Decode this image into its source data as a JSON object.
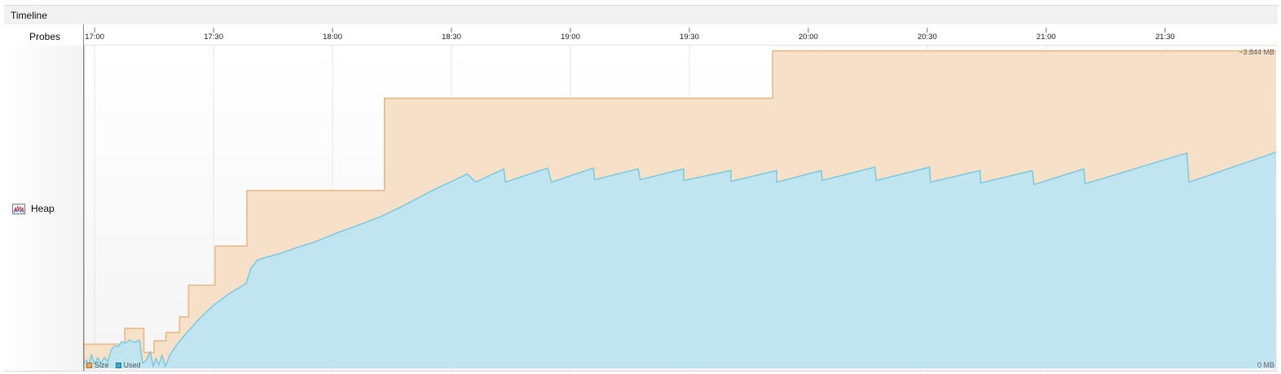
{
  "window": {
    "title": "Timeline"
  },
  "left_panel": {
    "probes_label": "Probes",
    "heap_label": "Heap"
  },
  "chart_labels": {
    "max": "~3.844 MB",
    "min": "0 MB"
  },
  "legend": {
    "size_label": "Size",
    "used_label": "Used"
  },
  "colors": {
    "size_fill": "#f5dec4",
    "size_line": "#e9b98a",
    "used_fill": "#bde5f3",
    "used_line": "#7ecbe0",
    "grid": "#e6e6e6"
  },
  "chart_data": {
    "type": "area",
    "title": "",
    "xlabel": "",
    "ylabel": "",
    "x_ticks": [
      "17:00",
      "17:30",
      "18:00",
      "18:30",
      "19:00",
      "19:30",
      "20:00",
      "20:30",
      "21:00",
      "21:30"
    ],
    "x_tick_minutes": [
      0,
      30,
      60,
      90,
      120,
      150,
      180,
      210,
      240,
      270
    ],
    "xlim_minutes": [
      -2.7,
      298
    ],
    "ylim_mb": [
      0,
      3.844
    ],
    "grid": true,
    "legend_position": "bottom-left",
    "series": [
      {
        "name": "Size",
        "step": true,
        "points": [
          [
            -2.7,
            0.29
          ],
          [
            7.6,
            0.29
          ],
          [
            7.6,
            0.48
          ],
          [
            12.4,
            0.48
          ],
          [
            12.4,
            0.19
          ],
          [
            15,
            0.19
          ],
          [
            15,
            0.33
          ],
          [
            18,
            0.33
          ],
          [
            18,
            0.43
          ],
          [
            21.4,
            0.43
          ],
          [
            21.4,
            0.62
          ],
          [
            23.7,
            0.62
          ],
          [
            23.7,
            1.0
          ],
          [
            30.4,
            1.0
          ],
          [
            30.4,
            1.47
          ],
          [
            38.4,
            1.47
          ],
          [
            38.4,
            2.14
          ],
          [
            73.1,
            2.14
          ],
          [
            73.1,
            3.25
          ],
          [
            171,
            3.25
          ],
          [
            171,
            3.82
          ],
          [
            298,
            3.82
          ]
        ]
      },
      {
        "name": "Used",
        "points": [
          [
            -2.7,
            0.06
          ],
          [
            -2.1,
            0.1
          ],
          [
            -1.5,
            0.04
          ],
          [
            -0.8,
            0.16
          ],
          [
            0,
            0.05
          ],
          [
            0.8,
            0.13
          ],
          [
            1.6,
            0.06
          ],
          [
            2.5,
            0.13
          ],
          [
            3.3,
            0.08
          ],
          [
            4.2,
            0.22
          ],
          [
            5,
            0.27
          ],
          [
            6,
            0.26
          ],
          [
            6.8,
            0.32
          ],
          [
            7.8,
            0.3
          ],
          [
            8.8,
            0.34
          ],
          [
            10,
            0.31
          ],
          [
            11.3,
            0.34
          ],
          [
            12.1,
            0.06
          ],
          [
            13.1,
            0.1
          ],
          [
            14,
            0.2
          ],
          [
            14.8,
            0.02
          ],
          [
            15.5,
            0.12
          ],
          [
            16.2,
            0.04
          ],
          [
            17,
            0.16
          ],
          [
            17.8,
            0.02
          ],
          [
            19,
            0.16
          ],
          [
            20.8,
            0.29
          ],
          [
            23.1,
            0.42
          ],
          [
            26.3,
            0.59
          ],
          [
            30,
            0.76
          ],
          [
            34,
            0.9
          ],
          [
            38.2,
            1.02
          ],
          [
            39.4,
            1.2
          ],
          [
            41,
            1.3
          ],
          [
            43.5,
            1.34
          ],
          [
            46.7,
            1.38
          ],
          [
            50.8,
            1.45
          ],
          [
            55.5,
            1.52
          ],
          [
            61.2,
            1.63
          ],
          [
            66.9,
            1.73
          ],
          [
            72.4,
            1.83
          ],
          [
            77.6,
            1.95
          ],
          [
            82,
            2.06
          ],
          [
            86,
            2.16
          ],
          [
            90.6,
            2.26
          ],
          [
            94,
            2.34
          ],
          [
            96.1,
            2.24
          ],
          [
            103.2,
            2.4
          ],
          [
            103.6,
            2.24
          ],
          [
            114.3,
            2.41
          ],
          [
            115.2,
            2.24
          ],
          [
            125.8,
            2.41
          ],
          [
            126.1,
            2.27
          ],
          [
            137.1,
            2.4
          ],
          [
            137.6,
            2.27
          ],
          [
            148.6,
            2.4
          ],
          [
            148.6,
            2.26
          ],
          [
            160.5,
            2.38
          ],
          [
            160.5,
            2.25
          ],
          [
            172,
            2.38
          ],
          [
            172,
            2.24
          ],
          [
            183.3,
            2.38
          ],
          [
            183.5,
            2.26
          ],
          [
            196.8,
            2.42
          ],
          [
            197.1,
            2.26
          ],
          [
            210.6,
            2.42
          ],
          [
            210.8,
            2.24
          ],
          [
            223.3,
            2.38
          ],
          [
            223.5,
            2.23
          ],
          [
            236.5,
            2.38
          ],
          [
            236.9,
            2.21
          ],
          [
            249.5,
            2.4
          ],
          [
            249.8,
            2.22
          ],
          [
            275.5,
            2.59
          ],
          [
            276,
            2.24
          ],
          [
            298,
            2.6
          ]
        ]
      }
    ]
  }
}
